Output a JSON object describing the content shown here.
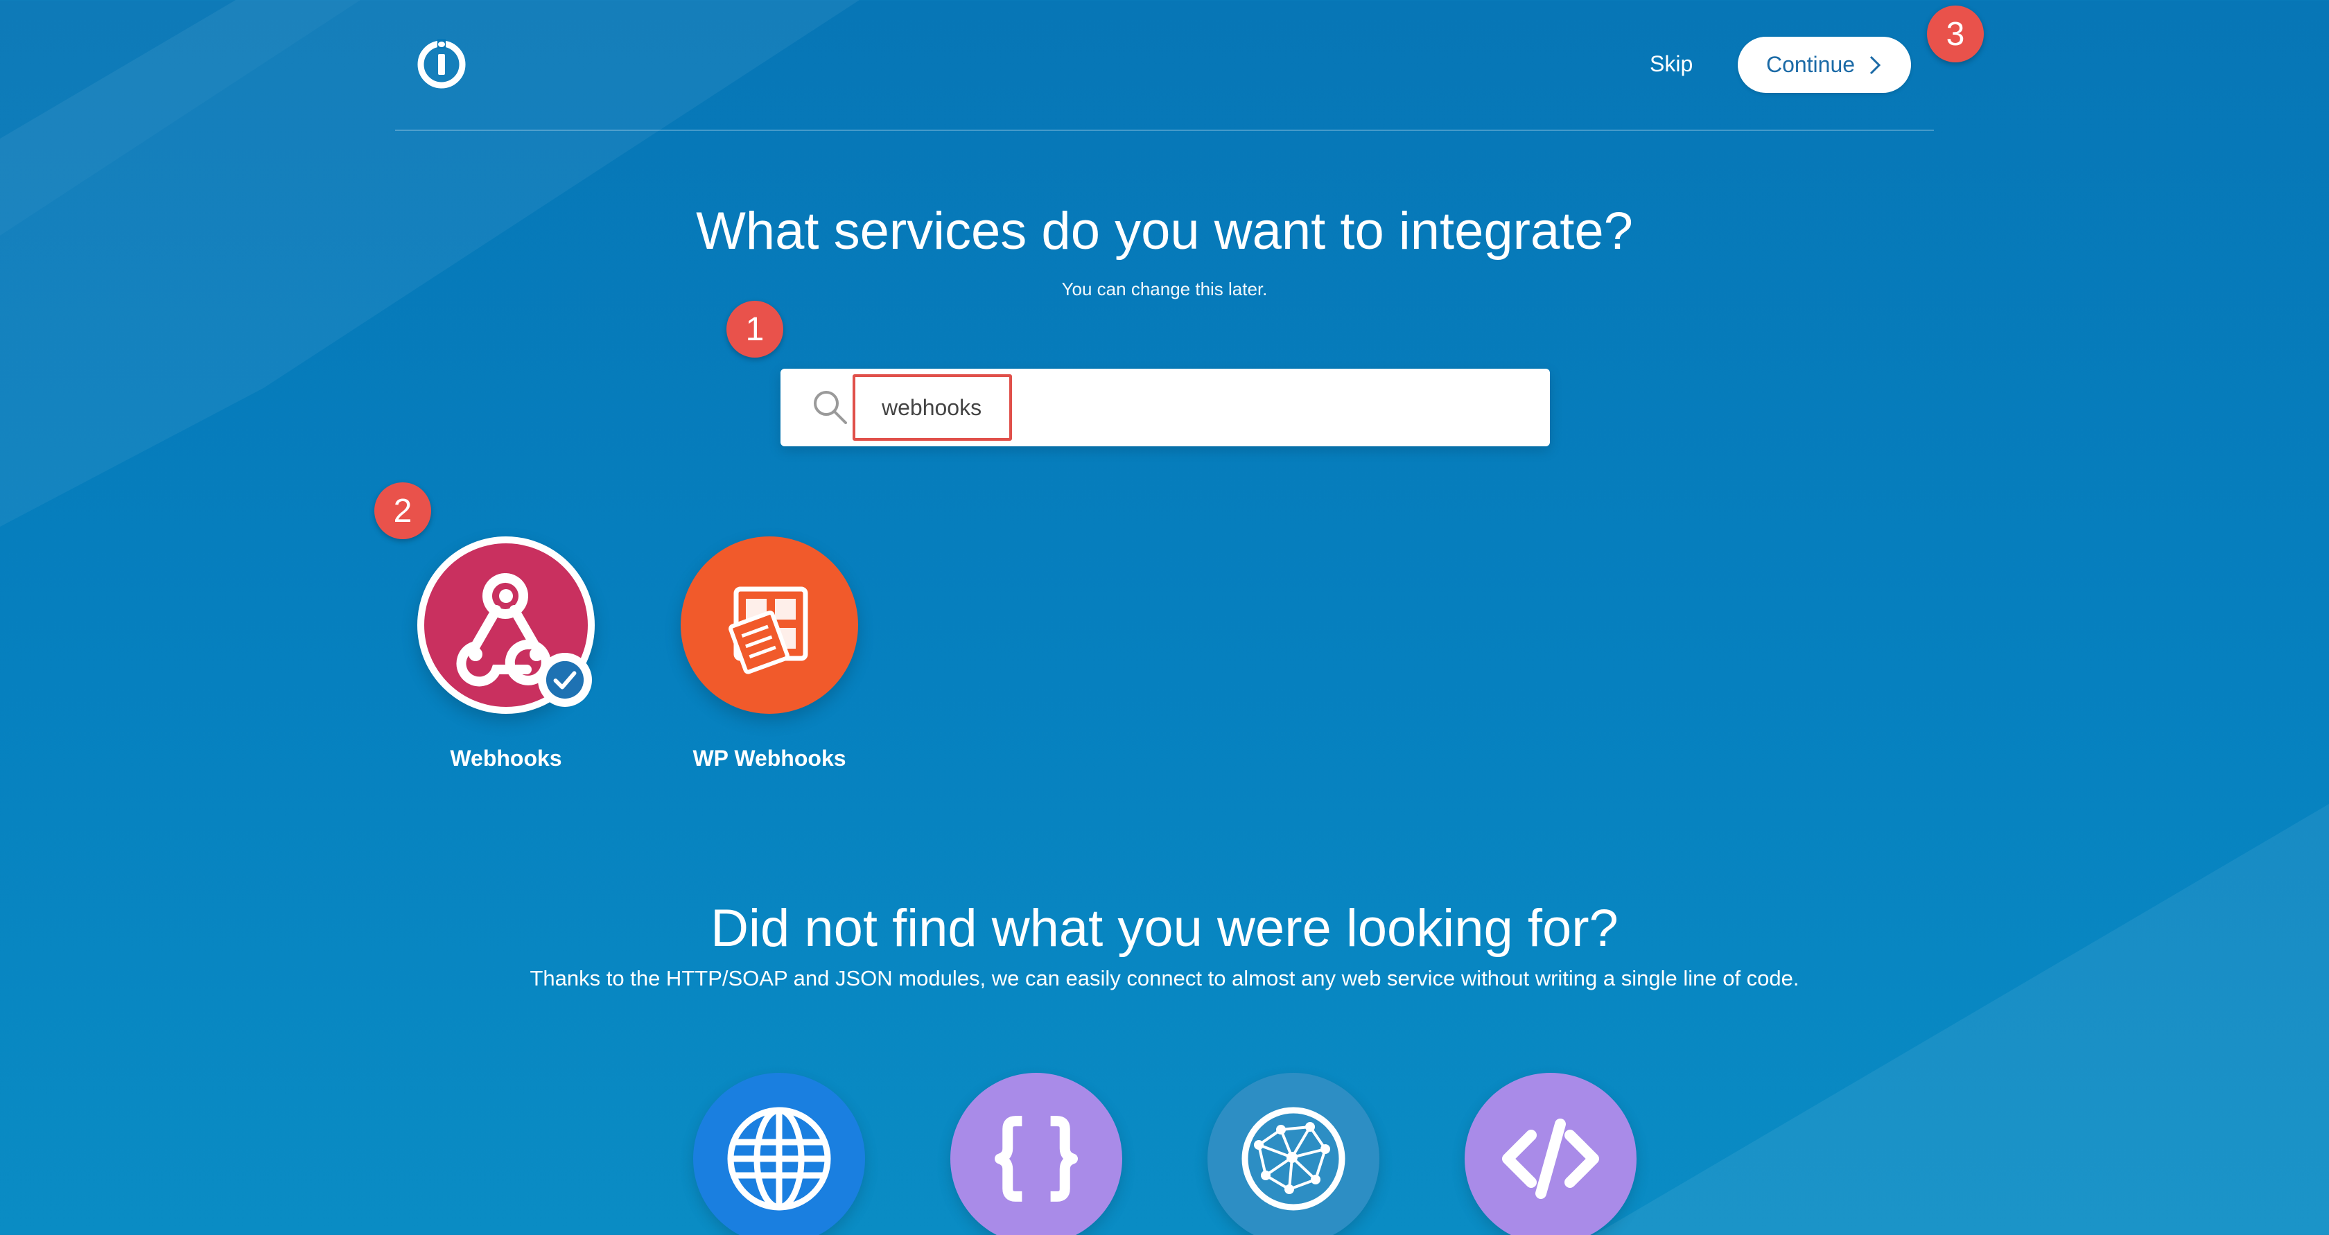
{
  "header": {
    "skip_label": "Skip",
    "continue_label": "Continue"
  },
  "annotations": [
    "1",
    "2",
    "3"
  ],
  "main": {
    "title": "What services do you want to integrate?",
    "subtitle": "You can change this later.",
    "search": {
      "value": "webhooks",
      "icon": "search-icon"
    },
    "apps": [
      {
        "label": "Webhooks",
        "icon": "webhooks-icon",
        "color": "#c9305f",
        "selected": true
      },
      {
        "label": "WP Webhooks",
        "icon": "wp-webhooks-icon",
        "color": "#f15a2b",
        "selected": false
      }
    ]
  },
  "fallback": {
    "title": "Did not find what you were looking for?",
    "text": "Thanks to the HTTP/SOAP and JSON modules, we can easily connect to almost any web service without writing a single line of code.",
    "modules": [
      {
        "icon": "globe-icon",
        "color": "#1a7fe0"
      },
      {
        "icon": "braces-icon",
        "color": "#a98be8"
      },
      {
        "icon": "network-globe-icon",
        "color": "#2d8ec4"
      },
      {
        "icon": "code-icon",
        "color": "#a98be8"
      }
    ]
  },
  "colors": {
    "background": "#0677b7",
    "accent": "#e9524b",
    "continue_text": "#1b6aa6"
  }
}
